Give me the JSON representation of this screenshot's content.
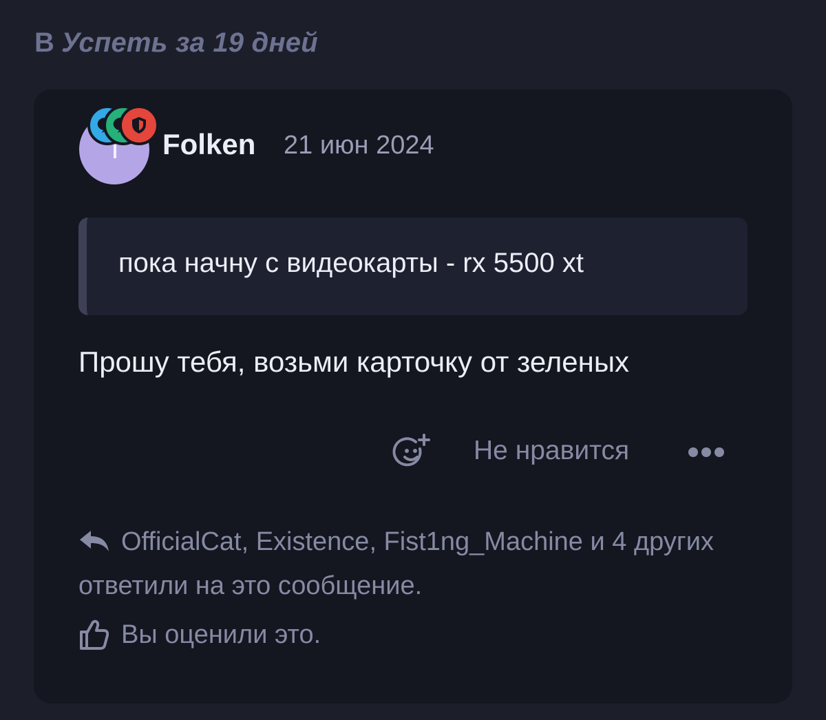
{
  "thread": {
    "prefix": "В",
    "title": "Успеть за 19 дней"
  },
  "post": {
    "author": "Folken",
    "date": "21 июн 2024",
    "avatar_color": "#b4a6e6",
    "badges": [
      {
        "icon": "chat-icon",
        "color": "#33a9e7"
      },
      {
        "icon": "chat-icon",
        "color": "#26b07a"
      },
      {
        "icon": "shield-icon",
        "color": "#e4463b"
      }
    ],
    "quote": "пока начну с видеокарты - rx 5500 xt",
    "message": "Прошу тебя, возьми карточку от зеленых"
  },
  "actions": {
    "react_icon": "add-reaction-icon",
    "dislike_label": "Не нравится",
    "more_icon": "more-icon"
  },
  "replies": {
    "icon": "reply-icon",
    "text": "OfficialCat, Existence, Fist1ng_Machine и 4 других ответили на это сообщение."
  },
  "reaction": {
    "icon": "thumbs-up-icon",
    "text": "Вы оценили это."
  }
}
